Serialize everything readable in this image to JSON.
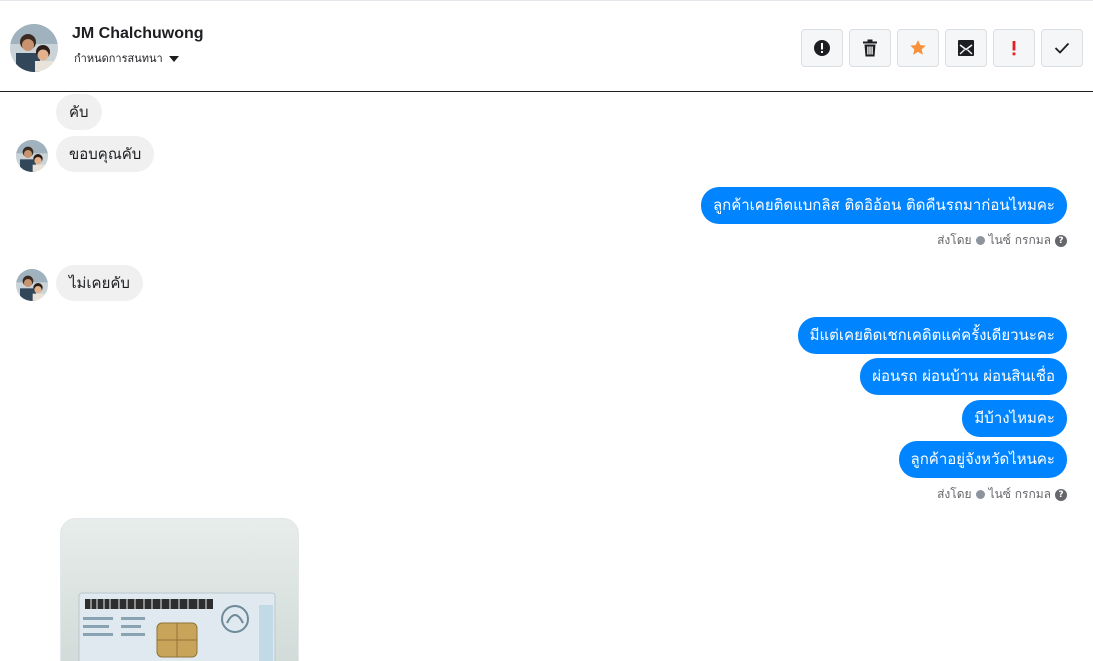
{
  "header": {
    "contact_name": "JM Chalchuwong",
    "assign_label": "กำหนดการสนทนา",
    "toolbar": [
      {
        "icon": "spam-alert-icon",
        "color": "#1c1e21"
      },
      {
        "icon": "trash-icon",
        "color": "#1c1e21"
      },
      {
        "icon": "star-icon",
        "color": "#f7923a"
      },
      {
        "icon": "mark-unread-icon",
        "color": "#1c1e21"
      },
      {
        "icon": "follow-up-icon",
        "color": "#e02020"
      },
      {
        "icon": "done-check-icon",
        "color": "#1c1e21"
      }
    ]
  },
  "messages": [
    {
      "side": "in",
      "text": "คับ",
      "avatar": false
    },
    {
      "side": "in",
      "text": "ขอบคุณคับ",
      "avatar": true
    },
    {
      "side": "out",
      "text": "ลูกค้าเคยติดแบกลิส ติดอิอ้อน ติดคืนรถมาก่อนไหมคะ"
    },
    {
      "side": "in",
      "text": "ไม่เคยคับ",
      "avatar": true
    },
    {
      "side": "out",
      "text": "มีแต่เคยติดเชกเคดิตแค่ครั้งเดียวนะคะ"
    },
    {
      "side": "out",
      "text": "ผ่อนรถ ผ่อนบ้าน ผ่อนสินเชื่อ"
    },
    {
      "side": "out",
      "text": "มีบ้างไหมคะ"
    },
    {
      "side": "out",
      "text": "ลูกค้าอยู่จังหวัดไหนคะ"
    }
  ],
  "sent_by": {
    "prefix": "ส่งโดย",
    "agent": "ไนซ์ กรกมล",
    "help": "?"
  },
  "colors": {
    "outgoing_bubble": "#0084ff",
    "incoming_bubble": "#f0f0f0"
  }
}
